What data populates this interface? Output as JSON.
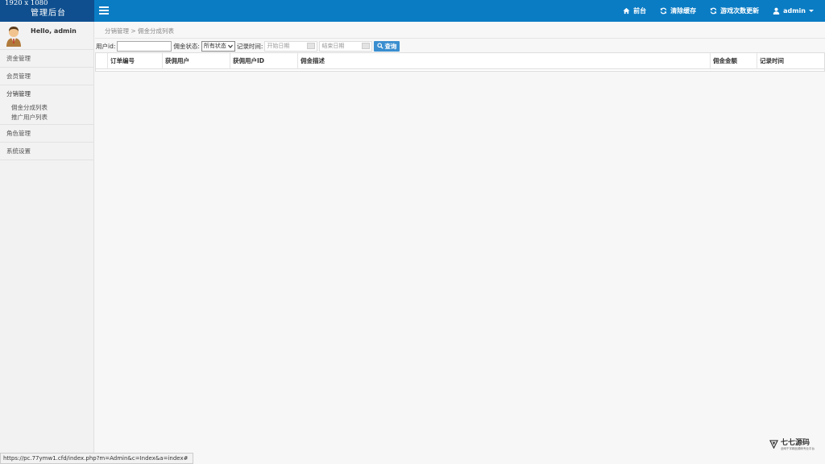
{
  "brand": {
    "resolution": "1920 x 1080",
    "title": "管理后台"
  },
  "topnav": {
    "items": [
      {
        "label": "前台",
        "icon": "home-icon"
      },
      {
        "label": "清除缓存",
        "icon": "refresh-icon"
      },
      {
        "label": "游戏次数更新",
        "icon": "refresh-icon"
      },
      {
        "label": "admin",
        "icon": "user-icon"
      }
    ]
  },
  "sidebar": {
    "greeting": "Hello, admin",
    "menu": [
      {
        "label": "资金管理"
      },
      {
        "label": "会员管理"
      },
      {
        "label": "分销管理",
        "children": [
          "佣金分成列表",
          "推广用户列表"
        ]
      },
      {
        "label": "角色管理"
      },
      {
        "label": "系统设置"
      }
    ]
  },
  "breadcrumb": "分销管理 > 佣金分成列表",
  "filters": {
    "user_id_label": "用户id:",
    "user_id_value": "",
    "status_label": "佣金状态:",
    "status_value": "所有状态",
    "time_label": "记录时间:",
    "start_placeholder": "开始日期",
    "end_placeholder": "结束日期",
    "query_label": "查询"
  },
  "table": {
    "columns": [
      "订单编号",
      "获佣用户",
      "获佣用户ID",
      "佣金描述",
      "佣金金额",
      "记录时间"
    ]
  },
  "status_url": "https://pc.77ymw1.cfd/index.php?m=Admin&c=Index&a=index#",
  "watermark": {
    "title": "七七源码",
    "subtitle": "全网千字精品源码专业平台"
  },
  "colors": {
    "topbar": "#0a7cc4",
    "brand": "#0f4f8f",
    "button": "#3a8ecf"
  }
}
